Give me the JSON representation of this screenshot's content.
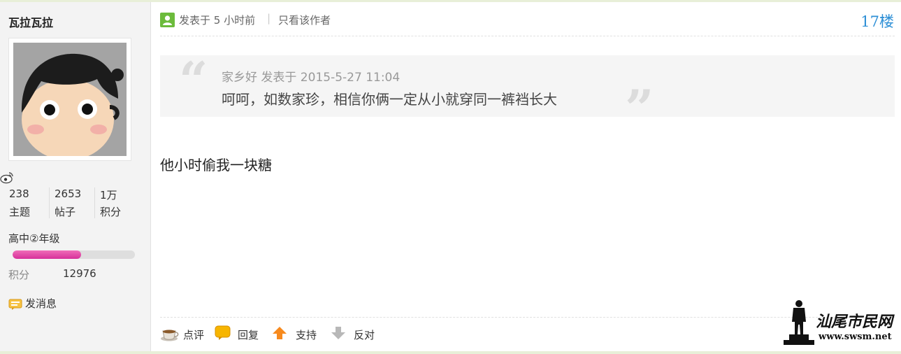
{
  "sidebar": {
    "username": "瓦拉瓦拉",
    "stats": [
      {
        "value": "238",
        "label": "主题"
      },
      {
        "value": "2653",
        "label": "帖子"
      },
      {
        "value": "1万",
        "label": "积分"
      }
    ],
    "level_name": "高中②年级",
    "level_progress": 0.56,
    "points_label": "积分",
    "points_value": "12976",
    "message_label": "发消息"
  },
  "post": {
    "posted_time": "发表于 5 小时前",
    "author_only": "只看该作者",
    "floor": "17楼",
    "quote": {
      "meta": "家乡好 发表于 2015-5-27 11:04",
      "text": "呵呵，如数家珍，相信你俩一定从小就穿同一裤裆长大"
    },
    "body": "他小时偷我一块糖"
  },
  "actions": [
    {
      "label": "点评",
      "icon": "comment-cup-icon"
    },
    {
      "label": "回复",
      "icon": "reply-bubble-icon"
    },
    {
      "label": "支持",
      "icon": "arrow-up-icon"
    },
    {
      "label": "反对",
      "icon": "arrow-down-icon"
    }
  ],
  "watermark": {
    "title": "汕尾市民网",
    "url": "www.swsm.net"
  },
  "colors": {
    "floor": "#2d8fd6",
    "level_bar": "#e04aa8",
    "sidebar_bg": "#f3f3f3"
  }
}
